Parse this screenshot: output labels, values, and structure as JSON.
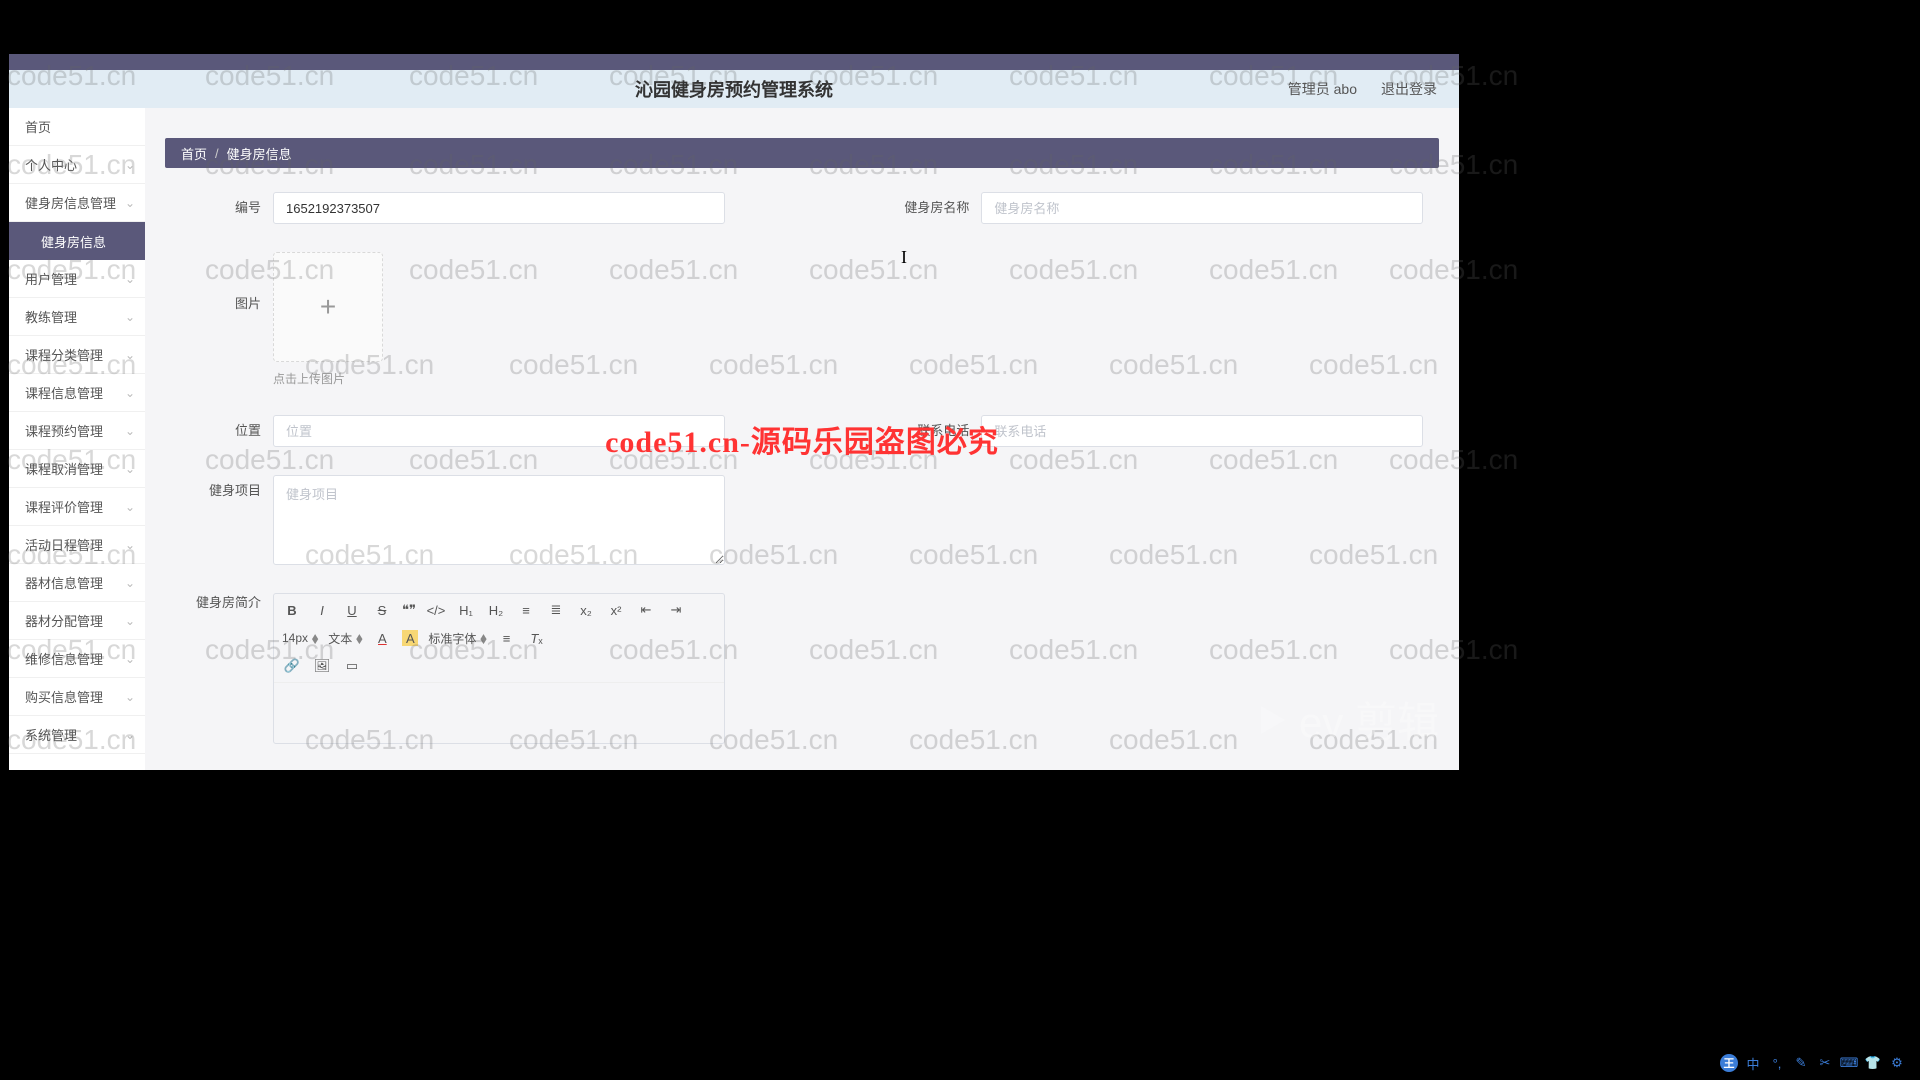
{
  "header": {
    "title": "沁园健身房预约管理系统",
    "admin_label": "管理员 abo",
    "logout_label": "退出登录"
  },
  "sidebar": {
    "items": [
      {
        "label": "首页",
        "arrow": false
      },
      {
        "label": "个人中心",
        "arrow": true
      },
      {
        "label": "健身房信息管理",
        "arrow": true
      },
      {
        "label": "健身房信息",
        "arrow": false,
        "sub": true
      },
      {
        "label": "用户管理",
        "arrow": true
      },
      {
        "label": "教练管理",
        "arrow": true
      },
      {
        "label": "课程分类管理",
        "arrow": true
      },
      {
        "label": "课程信息管理",
        "arrow": true
      },
      {
        "label": "课程预约管理",
        "arrow": true
      },
      {
        "label": "课程取消管理",
        "arrow": true
      },
      {
        "label": "课程评价管理",
        "arrow": true
      },
      {
        "label": "活动日程管理",
        "arrow": true
      },
      {
        "label": "器材信息管理",
        "arrow": true
      },
      {
        "label": "器材分配管理",
        "arrow": true
      },
      {
        "label": "维修信息管理",
        "arrow": true
      },
      {
        "label": "购买信息管理",
        "arrow": true
      },
      {
        "label": "系统管理",
        "arrow": true
      }
    ]
  },
  "breadcrumb": {
    "home": "首页",
    "current": "健身房信息"
  },
  "form": {
    "code_label": "编号",
    "code_value": "1652192373507",
    "name_label": "健身房名称",
    "name_placeholder": "健身房名称",
    "image_label": "图片",
    "upload_hint": "点击上传图片",
    "location_label": "位置",
    "location_placeholder": "位置",
    "phone_label": "联系电话",
    "phone_placeholder": "联系电话",
    "items_label": "健身项目",
    "items_placeholder": "健身项目",
    "intro_label": "健身房简介"
  },
  "editor": {
    "font_size": "14px",
    "font_family_label": "文本",
    "font_standard": "标准字体"
  },
  "watermark_text": "code51.cn",
  "center_overlay": "code51.cn-源码乐园盗图必究",
  "ev_logo": "ev 剪辑"
}
